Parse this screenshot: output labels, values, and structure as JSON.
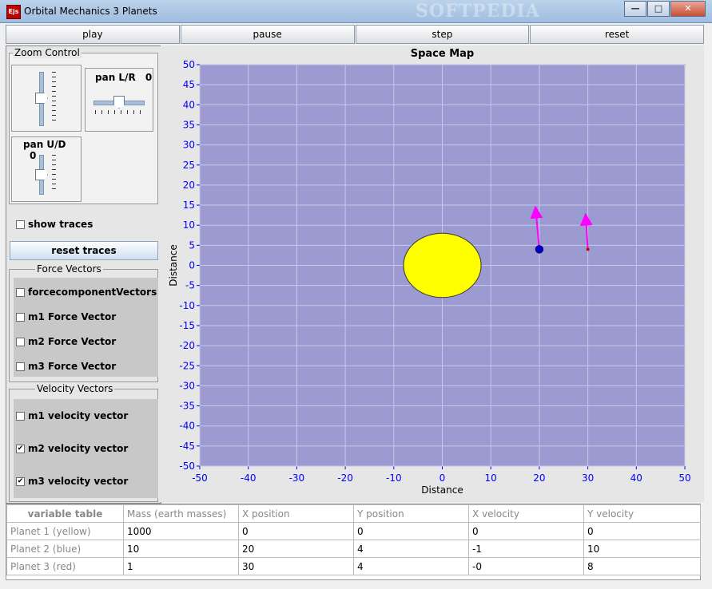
{
  "window": {
    "title": "Orbital Mechanics 3 Planets",
    "icon_text": "Ejs",
    "watermark": "SOFTPEDIA"
  },
  "controls": {
    "play": "play",
    "pause": "pause",
    "step": "step",
    "reset": "reset"
  },
  "zoom": {
    "legend": "Zoom Control",
    "pan_lr_label": "pan L/R",
    "pan_lr_value": "0",
    "pan_ud_label": "pan U/D",
    "pan_ud_value": "0"
  },
  "traces": {
    "show_label": "show traces",
    "show_checked": false,
    "reset_label": "reset traces"
  },
  "force_vectors": {
    "legend": "Force Vectors",
    "items": [
      {
        "label": "forcecomponentVectors",
        "checked": false
      },
      {
        "label": "m1 Force Vector",
        "checked": false
      },
      {
        "label": "m2 Force Vector",
        "checked": false
      },
      {
        "label": "m3 Force Vector",
        "checked": false
      }
    ]
  },
  "velocity_vectors": {
    "legend": "Velocity Vectors",
    "items": [
      {
        "label": "m1 velocity vector",
        "checked": false
      },
      {
        "label": "m2 velocity vector",
        "checked": true
      },
      {
        "label": "m3 velocity vector",
        "checked": true
      }
    ]
  },
  "plot": {
    "title": "Space Map",
    "xlabel": "Distance",
    "ylabel": "Distance",
    "xlim": [
      -50,
      50
    ],
    "ylim": [
      -50,
      50
    ],
    "xticks": [
      -50,
      -40,
      -30,
      -20,
      -10,
      0,
      10,
      20,
      30,
      40,
      50
    ],
    "yticks": [
      50,
      45,
      40,
      35,
      30,
      25,
      20,
      15,
      10,
      5,
      0,
      -5,
      -10,
      -15,
      -20,
      -25,
      -30,
      -35,
      -40,
      -45,
      -50
    ],
    "background": "#9b9bd2",
    "tick_color": "#0000ff",
    "grid_color": "#c8c8e6",
    "sun": {
      "x": 0,
      "y": 0,
      "color": "#ffff00"
    },
    "planet2": {
      "x": 20,
      "y": 4,
      "color": "#0000cc"
    },
    "planet3": {
      "x": 30,
      "y": 4,
      "color": "#cc0000"
    },
    "velocity_arrows": [
      {
        "x0": 20,
        "y0": 4,
        "x1": 19.3,
        "y1": 13.3,
        "color": "#ff00ff"
      },
      {
        "x0": 30,
        "y0": 4,
        "x1": 29.6,
        "y1": 11.5,
        "color": "#ff00ff"
      }
    ]
  },
  "variable_table": {
    "headers": [
      "variable table",
      "Mass (earth masses)",
      "X position",
      "Y position",
      "X velocity",
      "Y velocity"
    ],
    "rows": [
      [
        "Planet 1 (yellow)",
        "1000",
        "0",
        "0",
        "0",
        "0"
      ],
      [
        "Planet 2 (blue)",
        "10",
        "20",
        "4",
        "-1",
        "10"
      ],
      [
        "Planet 3 (red)",
        "1",
        "30",
        "4",
        "-0",
        "8"
      ]
    ]
  }
}
